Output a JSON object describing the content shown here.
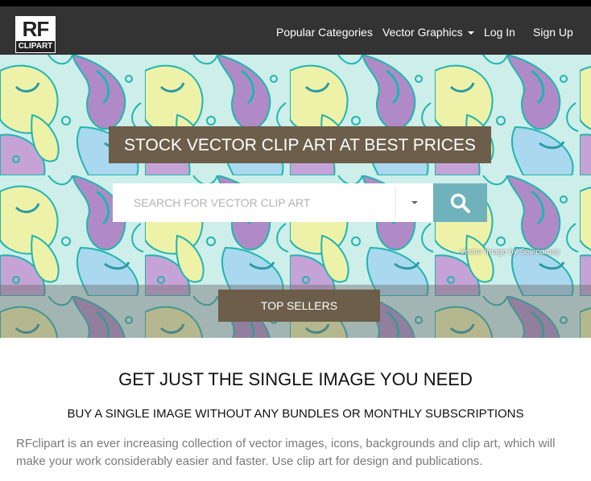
{
  "logo": {
    "main": "RF",
    "sub": "CLIPART"
  },
  "nav": {
    "items": [
      {
        "label": "Popular Categories"
      },
      {
        "label": "Vector Graphics"
      },
      {
        "label": "Log In"
      },
      {
        "label": "Sign Up"
      }
    ]
  },
  "hero": {
    "title": "STOCK VECTOR CLIP ART AT BEST PRICES",
    "search_placeholder": "SEARCH FOR VECTOR CLIP ART",
    "credit": "Vector image by Selenamay",
    "top_sellers_label": "TOP SELLERS"
  },
  "content": {
    "heading": "GET JUST THE SINGLE IMAGE YOU NEED",
    "subheading": "BUY A SINGLE IMAGE WITHOUT ANY BUNDLES OR MONTHLY SUBSCRIPTIONS",
    "paragraph": "RFclipart is an ever increasing collection of vector images, icons, backgrounds and clip art, which will make your work considerably easier and faster. Use clip art for design and publications."
  },
  "colors": {
    "navbar": "#333333",
    "brown_button": "#6c5e4a",
    "search_button": "#6fb2bb",
    "pattern_teal": "#1fb5b0",
    "pattern_purple": "#b08ac6",
    "pattern_yellow": "#eef2a8",
    "pattern_blue": "#a9d8ef"
  },
  "icons": {
    "search": "search-icon",
    "dropdown": "chevron-down-icon"
  }
}
